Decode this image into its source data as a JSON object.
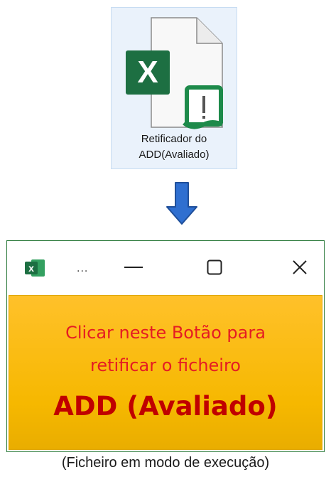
{
  "file": {
    "icon": "excel-file-warning-icon",
    "label_line1": "Retificador do",
    "label_line2": "ADD(Avaliado)"
  },
  "arrow": {
    "icon": "down-arrow-icon"
  },
  "window": {
    "app_icon": "excel-icon",
    "app_icon_letter": "x",
    "title_ellipsis": "...",
    "minimize_icon": "minimize-icon",
    "maximize_icon": "maximize-icon",
    "close_icon": "close-icon"
  },
  "action_button": {
    "line1": "Clicar neste Botão para",
    "line2": "retificar o ficheiro",
    "line3": "ADD (Avaliado)"
  },
  "caption": "(Ficheiro em modo de execução)",
  "colors": {
    "excel_green": "#1d6f42",
    "button_yellow": "#ffc12a",
    "text_red": "#e51c23",
    "text_dark_red": "#c00000",
    "arrow_blue": "#2f6fd0"
  }
}
